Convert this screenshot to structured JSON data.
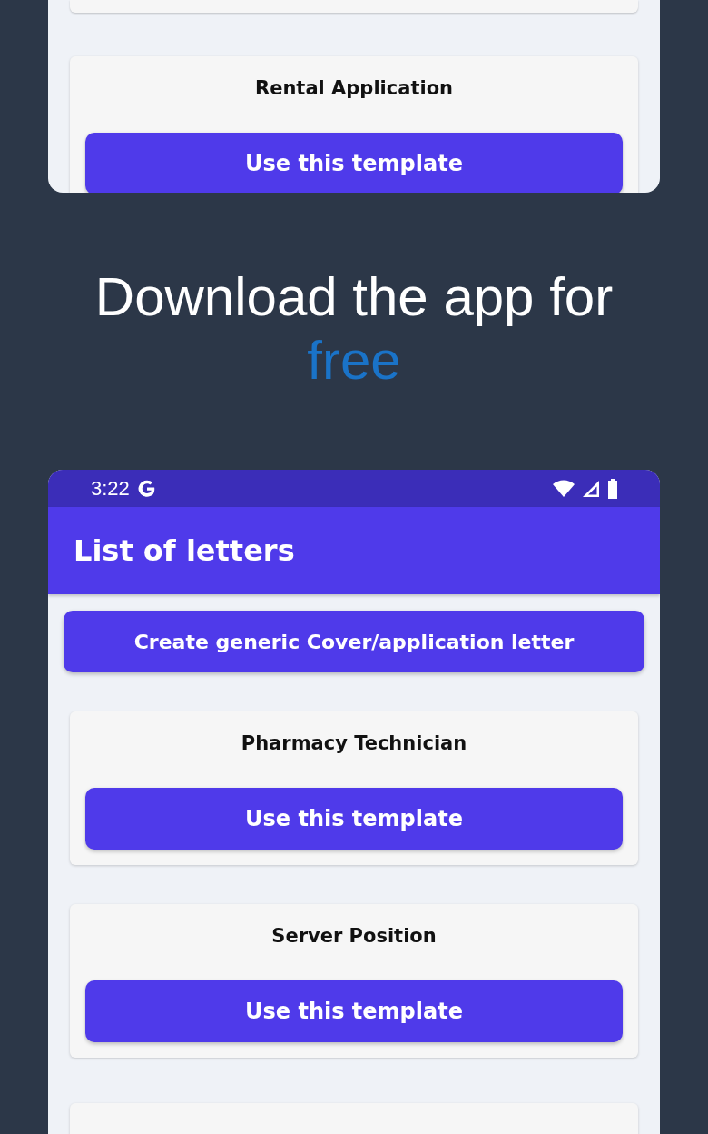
{
  "top_screen": {
    "cards": [
      {
        "kind": "stub"
      },
      {
        "kind": "full",
        "title": "Rental Application",
        "button": "Use this template"
      }
    ]
  },
  "headline": {
    "text": "Download the app for",
    "highlight": "free"
  },
  "bottom_screen": {
    "status_bar": {
      "time": "3:22"
    },
    "app_bar": {
      "title": "List of letters"
    },
    "create_button": "Create generic Cover/application letter",
    "cards": [
      {
        "kind": "full",
        "title": "Pharmacy Technician",
        "button": "Use this template"
      },
      {
        "kind": "full",
        "title": "Server Position",
        "button": "Use this template"
      },
      {
        "kind": "stub"
      }
    ]
  }
}
